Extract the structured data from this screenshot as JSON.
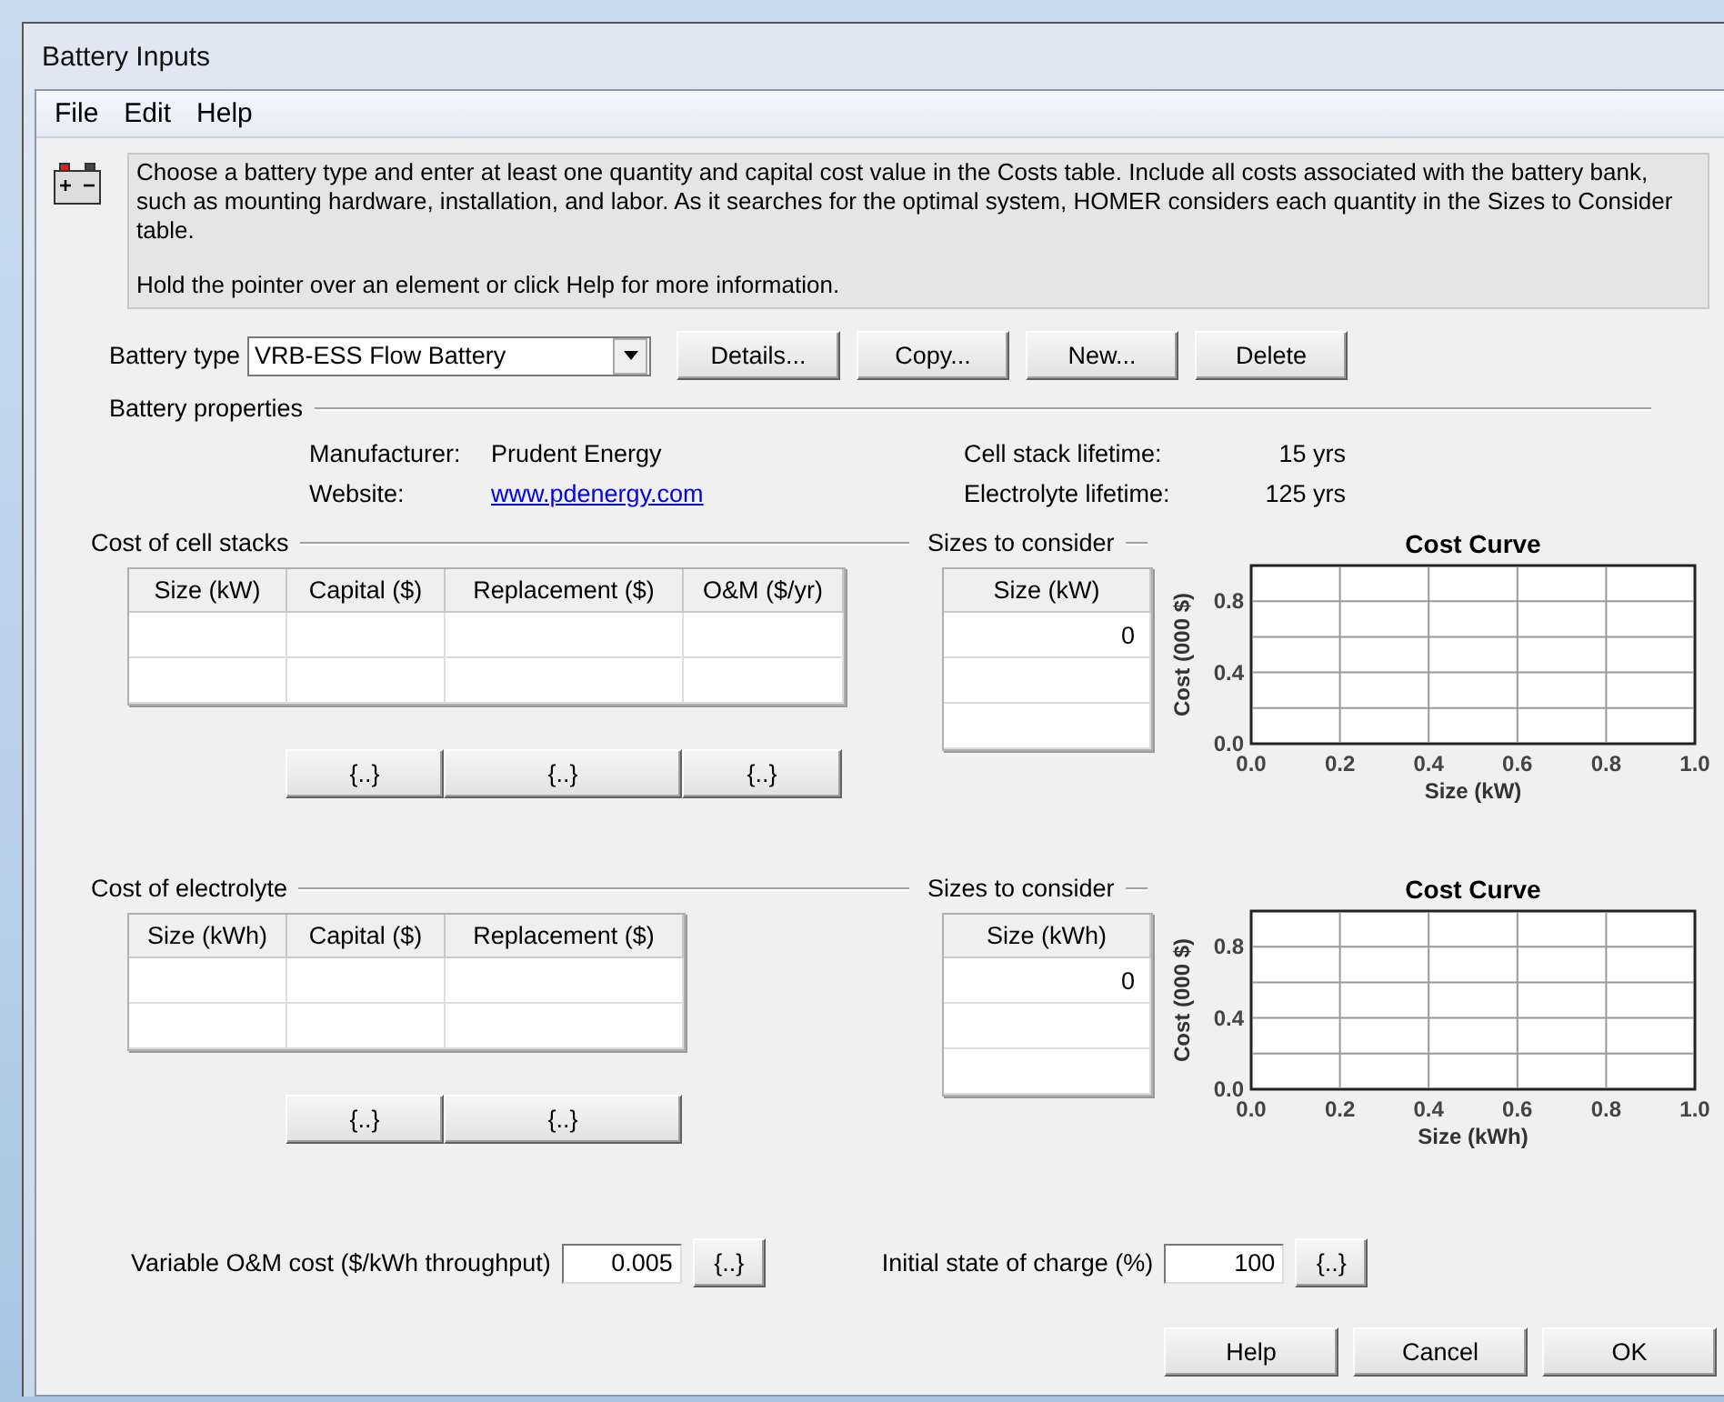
{
  "window": {
    "title": "Battery Inputs"
  },
  "menu": [
    "File",
    "Edit",
    "Help"
  ],
  "info": {
    "paragraphs": [
      "Choose a battery type and enter at least one quantity and capital cost value in the Costs table. Include all costs associated with the battery bank, such as mounting hardware, installation, and labor. As it searches for the optimal system, HOMER considers each quantity in the Sizes to Consider table.",
      "Hold the pointer over an element or click Help for more information."
    ]
  },
  "battery_type": {
    "label": "Battery type",
    "value": "VRB-ESS Flow Battery",
    "buttons": [
      "Details...",
      "Copy...",
      "New...",
      "Delete"
    ]
  },
  "properties": {
    "title": "Battery properties",
    "left": [
      {
        "label": "Manufacturer:",
        "value": "Prudent Energy",
        "kind": "text"
      },
      {
        "label": "Website:",
        "value": "www.pdenergy.com",
        "kind": "link"
      }
    ],
    "right": [
      {
        "label": "Cell stack lifetime:",
        "value": "15 yrs"
      },
      {
        "label": "Electrolyte lifetime:",
        "value": "125 yrs"
      }
    ]
  },
  "sections": [
    {
      "title": "Cost of cell stacks",
      "columns": [
        "Size (kW)",
        "Capital ($)",
        "Replacement ($)",
        "O&M ($/yr)"
      ],
      "buttons": [
        "{..}",
        "{..}",
        "{..}"
      ],
      "sizes": {
        "title": "Sizes to consider",
        "column": "Size (kW)",
        "rows": [
          "0"
        ]
      },
      "chart_data": {
        "type": "line",
        "title": "Cost Curve",
        "xlabel": "Size (kW)",
        "ylabel": "Cost (000 $)",
        "xlim": [
          0,
          1
        ],
        "ylim": [
          0,
          1
        ],
        "grid": true,
        "xticks": [
          {
            "value": 0,
            "label": "0.0"
          },
          {
            "value": 0.2,
            "label": "0.2"
          },
          {
            "value": 0.4,
            "label": "0.4"
          },
          {
            "value": 0.6,
            "label": "0.6"
          },
          {
            "value": 0.8,
            "label": "0.8"
          },
          {
            "value": 1,
            "label": "1.0"
          }
        ],
        "yticks": [
          {
            "value": 0,
            "label": "0.0"
          },
          {
            "value": 0.4,
            "label": "0.4"
          },
          {
            "value": 0.8,
            "label": "0.8"
          }
        ]
      }
    },
    {
      "title": "Cost of electrolyte",
      "columns": [
        "Size (kWh)",
        "Capital ($)",
        "Replacement ($)"
      ],
      "buttons": [
        "{..}",
        "{..}"
      ],
      "sizes": {
        "title": "Sizes to consider",
        "column": "Size (kWh)",
        "rows": [
          "0"
        ]
      },
      "chart_data": {
        "type": "line",
        "title": "Cost Curve",
        "xlabel": "Size (kWh)",
        "ylabel": "Cost (000 $)",
        "xlim": [
          0,
          1
        ],
        "ylim": [
          0,
          1
        ],
        "grid": true,
        "xticks": [
          {
            "value": 0,
            "label": "0.0"
          },
          {
            "value": 0.2,
            "label": "0.2"
          },
          {
            "value": 0.4,
            "label": "0.4"
          },
          {
            "value": 0.6,
            "label": "0.6"
          },
          {
            "value": 0.8,
            "label": "0.8"
          },
          {
            "value": 1,
            "label": "1.0"
          }
        ],
        "yticks": [
          {
            "value": 0,
            "label": "0.0"
          },
          {
            "value": 0.4,
            "label": "0.4"
          },
          {
            "value": 0.8,
            "label": "0.8"
          }
        ]
      }
    }
  ],
  "fields": [
    {
      "label": "Variable O&M cost ($/kWh throughput)",
      "value": "0.005",
      "button": "{..}"
    },
    {
      "label": "Initial state of charge (%)",
      "value": "100",
      "button": "{..}"
    }
  ],
  "dialog_buttons": [
    "Help",
    "Cancel",
    "OK"
  ]
}
